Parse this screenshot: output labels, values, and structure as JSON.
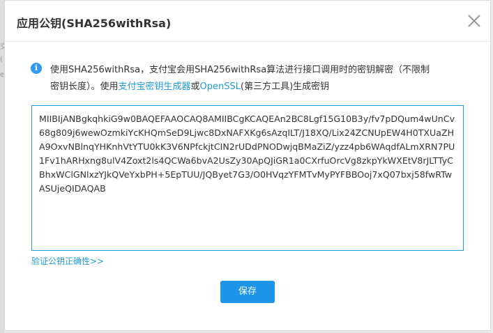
{
  "dialog": {
    "title": "应用公钥(SHA256withRsa)",
    "close_icon": "close-icon"
  },
  "info": {
    "icon": "info-icon",
    "text_line1": "使用SHA256withRsa，支付宝会用SHA256withRsa算法进行接口调用时的密钥解密（不限制",
    "text_line2_prefix": "密钥长度）。使用",
    "link_keygen": "支付宝密钥生成器",
    "text_or": "或",
    "link_openssl": "OpenSSL",
    "text_suffix": "(第三方工具)生成密钥"
  },
  "public_key": "MIIBIjANBgkqhkiG9w0BAQEFAAOCAQ8AMIIBCgKCAQEAn2BC8Lgf15G10B3y/fv7pDQum4wUnCv68g809j6wewOzmkiYcKHQmSeD9Ljwc8DxNAFXKg6sAzqILT/J18XQ/Lix24ZCNUpEW4H0TXUaZHA9OxvNBlnqYHKnhVtYTU0kK3V6NPfckjtCIN2rUDdPNODwjqBMaZiZ/yzz4pb6WAqdfALmXRN7PU1Fv1hARHxng8ulV4Zoxt2ls4QCWa6bvA2UsZy30ApQJiGR1a0CXrfuOrcVg8zkpYkWXEtV8rJLTTyCBhxWClGNlxzYJkQVeYxbPH+5EpTUU/JQByet7G3/O0HVqzYFMTvMyPYFBBOoj7xQ07bxj58fwRTwASUjeQIDAQAB",
  "verify_link": "验证公钥正确性>>",
  "save_button": "保存",
  "background": {
    "chars": [
      "交",
      "(",
      "e"
    ]
  }
}
